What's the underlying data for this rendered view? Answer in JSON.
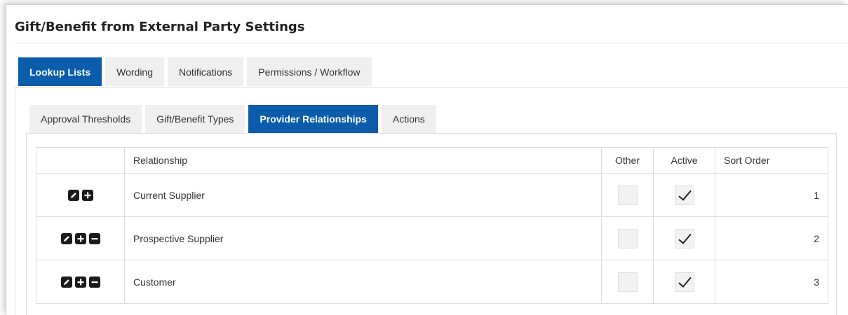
{
  "page": {
    "title": "Gift/Benefit from External Party Settings"
  },
  "main_tabs": [
    {
      "label": "Lookup Lists",
      "active": true
    },
    {
      "label": "Wording",
      "active": false
    },
    {
      "label": "Notifications",
      "active": false
    },
    {
      "label": "Permissions / Workflow",
      "active": false
    }
  ],
  "sub_tabs": [
    {
      "label": "Approval Thresholds",
      "active": false
    },
    {
      "label": "Gift/Benefit Types",
      "active": false
    },
    {
      "label": "Provider Relationships",
      "active": true
    },
    {
      "label": "Actions",
      "active": false
    }
  ],
  "table": {
    "headers": {
      "actions": "",
      "relationship": "Relationship",
      "other": "Other",
      "active": "Active",
      "sort_order": "Sort Order"
    },
    "rows": [
      {
        "relationship": "Current Supplier",
        "other": false,
        "active": true,
        "sort_order": "1",
        "icons": [
          "edit-icon",
          "add-icon"
        ]
      },
      {
        "relationship": "Prospective Supplier",
        "other": false,
        "active": true,
        "sort_order": "2",
        "icons": [
          "edit-icon",
          "add-icon",
          "remove-icon"
        ]
      },
      {
        "relationship": "Customer",
        "other": false,
        "active": true,
        "sort_order": "3",
        "icons": [
          "edit-icon",
          "add-icon",
          "remove-icon"
        ]
      }
    ]
  },
  "colors": {
    "accent": "#0b5cab",
    "tab_bg": "#efefef",
    "icon_bg": "#1b1b1b"
  }
}
